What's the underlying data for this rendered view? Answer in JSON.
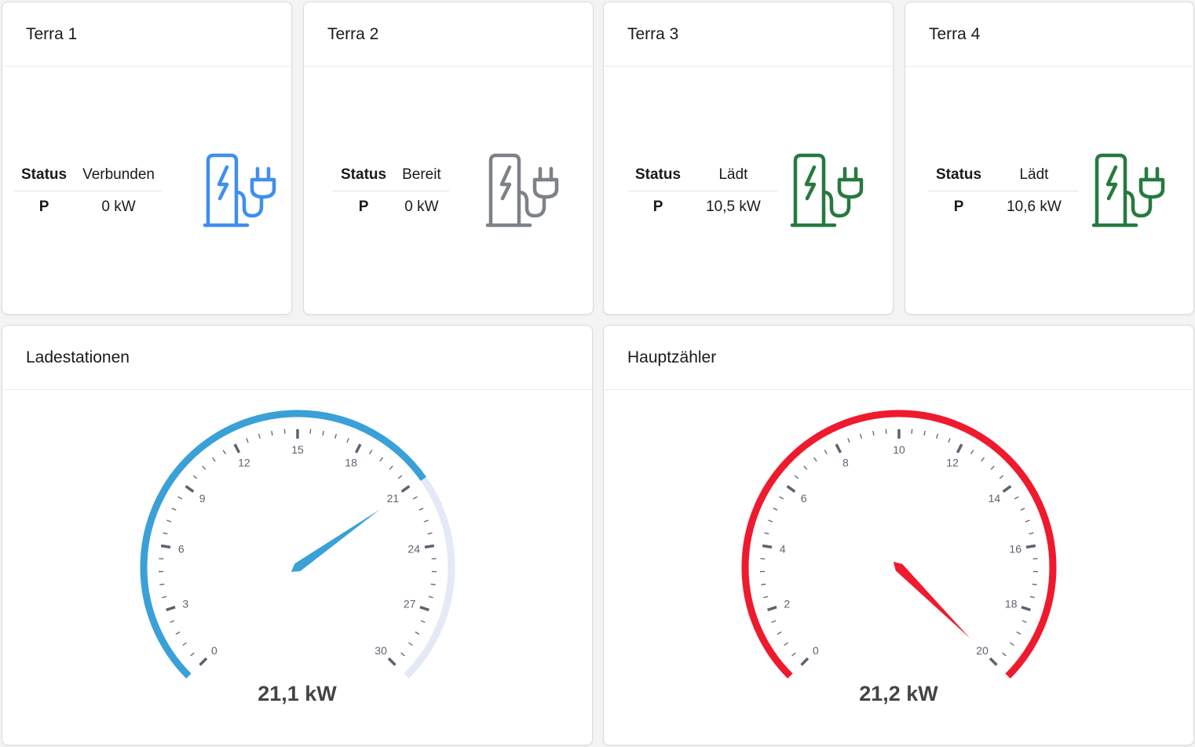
{
  "stations": [
    {
      "title": "Terra 1",
      "status_label": "Status",
      "status_value": "Verbunden",
      "power_label": "P",
      "power_value": "0 kW",
      "icon": "ev-charger-icon",
      "icon_color": "#3f8ef0"
    },
    {
      "title": "Terra 2",
      "status_label": "Status",
      "status_value": "Bereit",
      "power_label": "P",
      "power_value": "0 kW",
      "icon": "ev-charger-icon",
      "icon_color": "#7d8189"
    },
    {
      "title": "Terra 3",
      "status_label": "Status",
      "status_value": "Lädt",
      "power_label": "P",
      "power_value": "10,5 kW",
      "icon": "ev-charger-icon",
      "icon_color": "#267a3e"
    },
    {
      "title": "Terra 4",
      "status_label": "Status",
      "status_value": "Lädt",
      "power_label": "P",
      "power_value": "10,6 kW",
      "icon": "ev-charger-icon",
      "icon_color": "#267a3e"
    }
  ],
  "gauges": [
    {
      "title": "Ladestationen",
      "value": 21.1,
      "value_text": "21,1 kW",
      "min": 0,
      "max": 30,
      "major_ticks": [
        0,
        3,
        6,
        9,
        12,
        15,
        18,
        21,
        24,
        27,
        30
      ],
      "color": "#3aa0d8",
      "track_color": "#e3e9f5"
    },
    {
      "title": "Hauptzähler",
      "value": 21.2,
      "value_text": "21,2 kW",
      "min": 0,
      "max": 20,
      "major_ticks": [
        0,
        2,
        4,
        6,
        8,
        10,
        12,
        14,
        16,
        18,
        20
      ],
      "color": "#ef1a2d",
      "track_color": "#e3e9f5"
    }
  ]
}
